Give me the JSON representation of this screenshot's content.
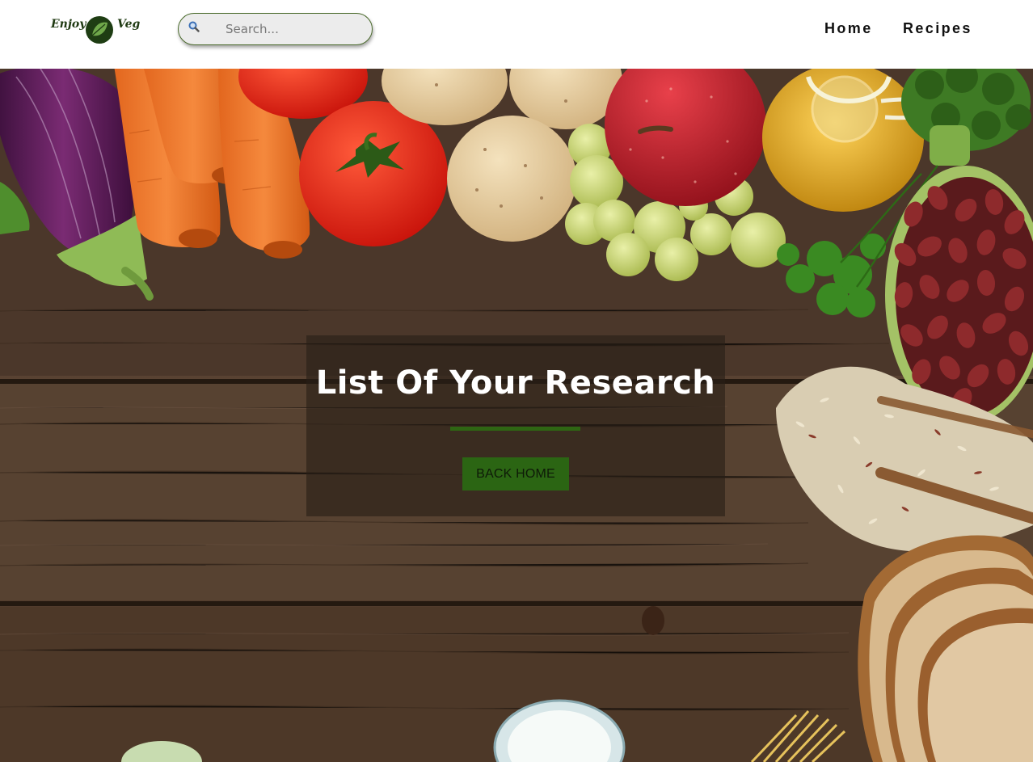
{
  "header": {
    "logo": {
      "left_word": "Enjoy",
      "right_word": "Veg"
    },
    "search": {
      "placeholder": "Search...",
      "icon": "search-icon"
    },
    "nav": [
      {
        "label": "Home"
      },
      {
        "label": "Recipes"
      }
    ]
  },
  "hero": {
    "title": "List Of Your Research",
    "button_label": "BACK HOME",
    "colors": {
      "accent": "#2b6513",
      "overlay": "rgba(40,30,22,0.62)"
    }
  }
}
